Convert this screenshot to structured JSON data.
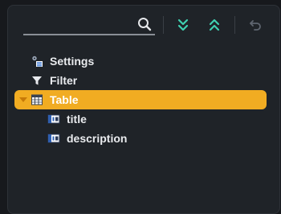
{
  "toolbar": {
    "search": {
      "value": "",
      "placeholder": ""
    },
    "icons": {
      "search": "search-icon",
      "expand_all": "double-chevron-down-icon",
      "collapse_all": "double-chevron-up-icon",
      "undo": "undo-arrow-icon"
    }
  },
  "tree": {
    "items": [
      {
        "label": "Settings",
        "icon": "settings-list-icon",
        "level": 1
      },
      {
        "label": "Filter",
        "icon": "funnel-icon",
        "level": 1
      },
      {
        "label": "Table",
        "icon": "table-icon",
        "level": 1,
        "selected": true,
        "expanded": true
      },
      {
        "label": "title",
        "icon": "field-icon",
        "level": 2
      },
      {
        "label": "description",
        "icon": "field-icon",
        "level": 2
      }
    ]
  },
  "colors": {
    "background": "#1f2328",
    "selection": "#f1ac22",
    "toolbar_accent": "#3fd0b0",
    "text": "#e9ebee"
  }
}
